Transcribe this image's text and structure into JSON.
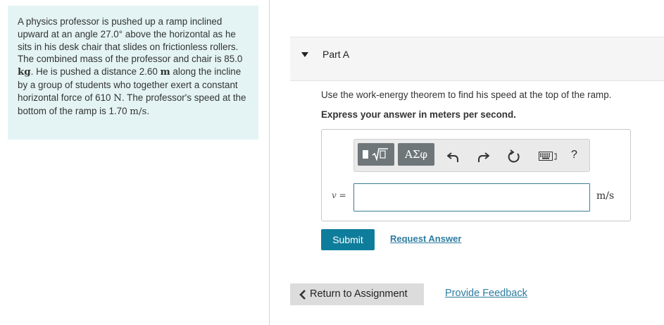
{
  "problem": {
    "seg1": "A physics professor is pushed up a ramp inclined upward at an angle 27.0",
    "degree": "°",
    "seg2": " above the horizontal as he sits in his desk chair that slides on frictionless rollers. The combined mass of the professor and chair is 85.0 ",
    "mass_unit": "kg",
    "seg3": ". He is pushed a distance 2.60 ",
    "dist_unit": "m",
    "seg4": " along the incline by a group of students who together exert a constant horizontal force of 610 ",
    "force_unit": "N",
    "seg5": ". The professor's speed at the bottom of the ramp is 1.70 ",
    "speed_unit": "m/s",
    "seg6": "."
  },
  "part": {
    "title": "Part A"
  },
  "question": {
    "instruction": "Use the work-energy theorem to find his speed at the top of the ramp.",
    "express": "Express your answer in meters per second."
  },
  "toolbar": {
    "symbols_label": "ΑΣφ",
    "help_label": "?",
    "icons": [
      "templates-icon",
      "undo-icon",
      "redo-icon",
      "reset-icon",
      "keyboard-icon",
      "help-icon"
    ]
  },
  "answer": {
    "variable": "v",
    "equals": " =",
    "value": "",
    "unit": "m/s"
  },
  "actions": {
    "submit": "Submit",
    "request_answer": "Request Answer"
  },
  "footer": {
    "return": "Return to Assignment",
    "feedback": "Provide Feedback"
  },
  "colors": {
    "problem_bg": "#e4f4f4",
    "submit_bg": "#0e7d9b",
    "link": "#2d7ca0",
    "toolbar_button": "#6f7679"
  }
}
